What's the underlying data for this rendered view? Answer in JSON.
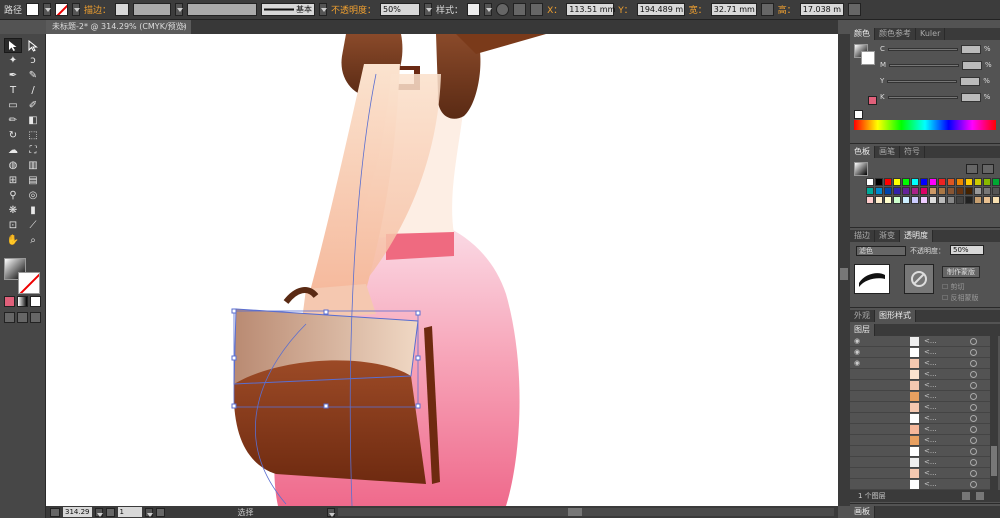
{
  "control_bar": {
    "selection_label": "路径",
    "stroke_label": "描边：",
    "brush_label": "基本",
    "opacity_label": "不透明度：",
    "opacity_value": "50%",
    "style_label": "样式：",
    "x_label": "X：",
    "x_value": "113.51 mm",
    "y_label": "Y：",
    "y_value": "194.489 m",
    "w_label": "宽：",
    "w_value": "32.71 mm",
    "h_label": "高：",
    "h_value": "17.038 m"
  },
  "document_tab": {
    "title": "未标题-2* @ 314.29% (CMYK/预览)",
    "close": "×"
  },
  "status_bar": {
    "zoom": "314.29",
    "page": "1",
    "tool_status": "选择"
  },
  "color_panel": {
    "tabs": [
      "颜色",
      "颜色参考",
      "Kuler"
    ],
    "channels": [
      {
        "label": "C",
        "unit": "%"
      },
      {
        "label": "M",
        "unit": "%"
      },
      {
        "label": "Y",
        "unit": "%"
      },
      {
        "label": "K",
        "unit": "%"
      }
    ]
  },
  "swatches_panel": {
    "tabs": [
      "色板",
      "画笔",
      "符号"
    ],
    "colors": [
      "#ffffff",
      "#000000",
      "#ff0000",
      "#ffff00",
      "#00ff00",
      "#00ffff",
      "#0000ff",
      "#ff00ff",
      "#ee2222",
      "#dd5522",
      "#ee8800",
      "#ffcc00",
      "#cccc00",
      "#88bb00",
      "#00aa33",
      "#00aa99",
      "#0088cc",
      "#0044aa",
      "#3322aa",
      "#662299",
      "#aa2288",
      "#dd0066",
      "#cc9966",
      "#aa7744",
      "#885533",
      "#663311",
      "#442200",
      "#999999",
      "#777777",
      "#555555",
      "#ffcccc",
      "#ffeecc",
      "#ffffcc",
      "#ccffcc",
      "#cceeff",
      "#ccccff",
      "#eeccff",
      "#dddddd",
      "#bbbbbb",
      "#888888",
      "#444444",
      "#222222",
      "#c8a070",
      "#e8c090",
      "#f8e0b0"
    ]
  },
  "transparency_panel": {
    "tabs": [
      "描边",
      "渐变",
      "透明度"
    ],
    "blend_mode": "滤色",
    "opacity_label": "不透明度：",
    "opacity_value": "50%",
    "make_mask": "制作蒙版",
    "clip": "剪切",
    "invert_mask": "反相蒙版"
  },
  "appearance_panel": {
    "tabs": [
      "外观",
      "图形样式"
    ]
  },
  "layers_panel": {
    "tabs": [
      "图层"
    ],
    "rows": [
      {
        "name": "<..."
      },
      {
        "name": "<..."
      },
      {
        "name": "<..."
      },
      {
        "name": "<..."
      },
      {
        "name": "<..."
      },
      {
        "name": "<..."
      },
      {
        "name": "<..."
      },
      {
        "name": "<..."
      },
      {
        "name": "<..."
      },
      {
        "name": "<..."
      },
      {
        "name": "<..."
      },
      {
        "name": "<..."
      },
      {
        "name": "<..."
      },
      {
        "name": "<..."
      }
    ],
    "footer": "1 个图层"
  },
  "artboards_panel": {
    "tabs": [
      "画板"
    ]
  }
}
